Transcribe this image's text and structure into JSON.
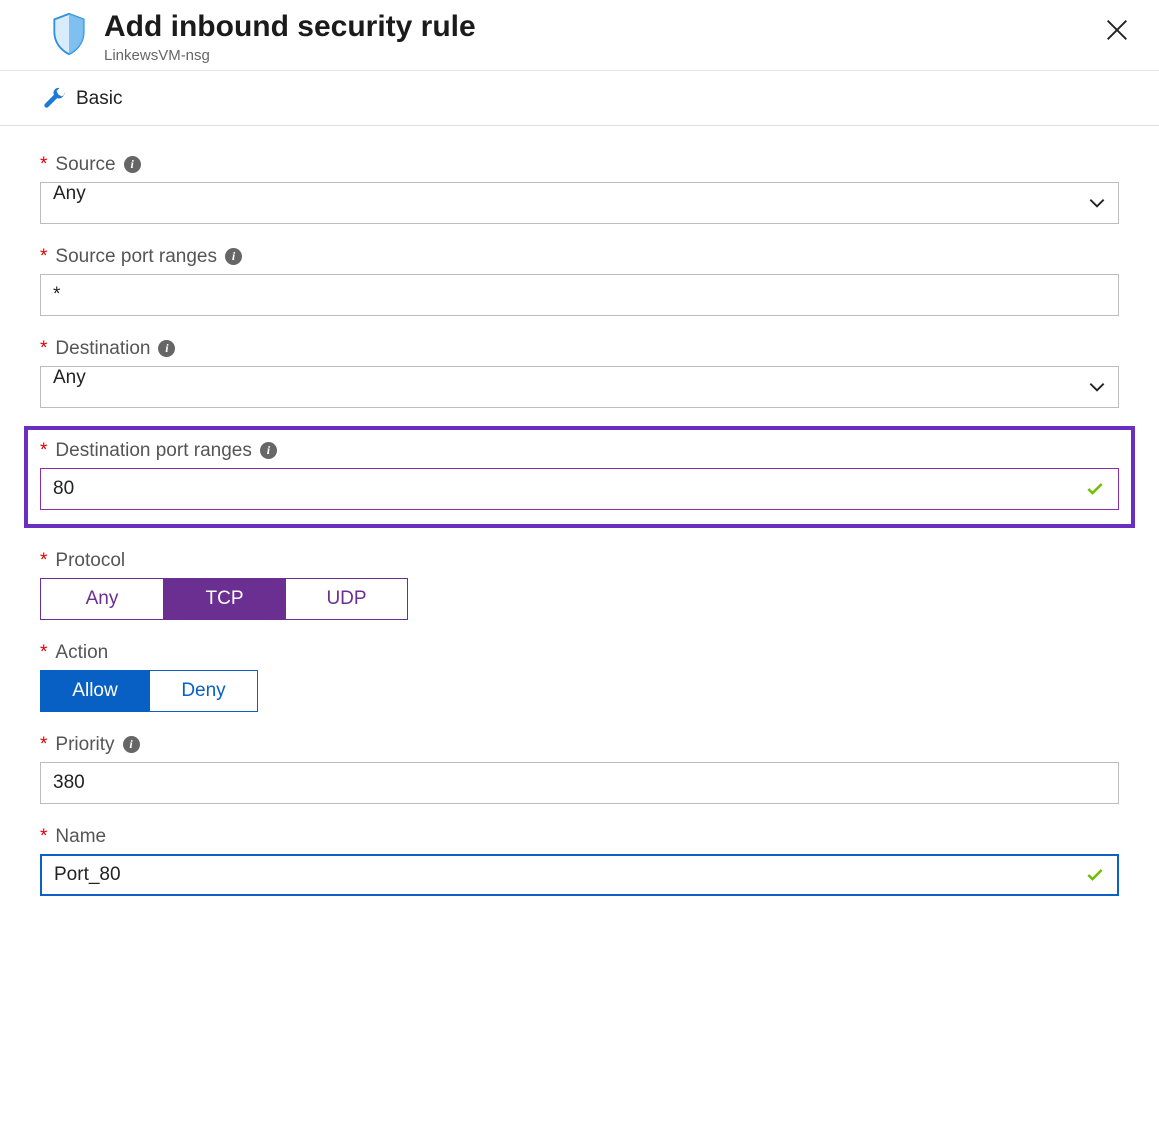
{
  "header": {
    "title": "Add inbound security rule",
    "subtitle": "LinkewsVM-nsg"
  },
  "toolbar": {
    "mode_label": "Basic"
  },
  "form": {
    "source": {
      "label": "Source",
      "value": "Any"
    },
    "source_port_ranges": {
      "label": "Source port ranges",
      "value": "*"
    },
    "destination": {
      "label": "Destination",
      "value": "Any"
    },
    "destination_port_ranges": {
      "label": "Destination port ranges",
      "value": "80"
    },
    "protocol": {
      "label": "Protocol",
      "options": [
        "Any",
        "TCP",
        "UDP"
      ],
      "selected": "TCP"
    },
    "action": {
      "label": "Action",
      "options": [
        "Allow",
        "Deny"
      ],
      "selected": "Allow"
    },
    "priority": {
      "label": "Priority",
      "value": "380"
    },
    "name": {
      "label": "Name",
      "value": "Port_80"
    }
  }
}
